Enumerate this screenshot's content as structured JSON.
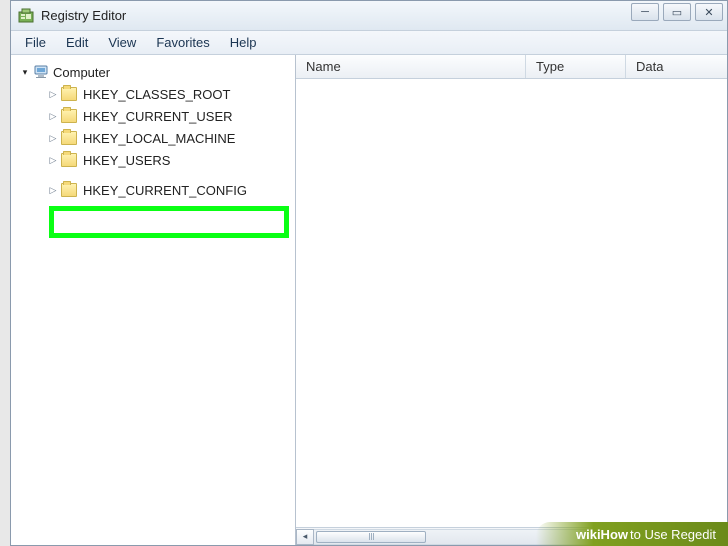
{
  "window": {
    "title": "Registry Editor"
  },
  "menu": {
    "file": "File",
    "edit": "Edit",
    "view": "View",
    "favorites": "Favorites",
    "help": "Help"
  },
  "tree": {
    "root": "Computer",
    "hives": {
      "classes_root": "HKEY_CLASSES_ROOT",
      "current_user": "HKEY_CURRENT_USER",
      "local_machine": "HKEY_LOCAL_MACHINE",
      "users": "HKEY_USERS",
      "current_config": "HKEY_CURRENT_CONFIG"
    },
    "highlighted": "current_config"
  },
  "list": {
    "headers": {
      "name": "Name",
      "type": "Type",
      "data": "Data"
    }
  },
  "watermark": {
    "brand": "wikiHow",
    "text": " to Use Regedit"
  }
}
